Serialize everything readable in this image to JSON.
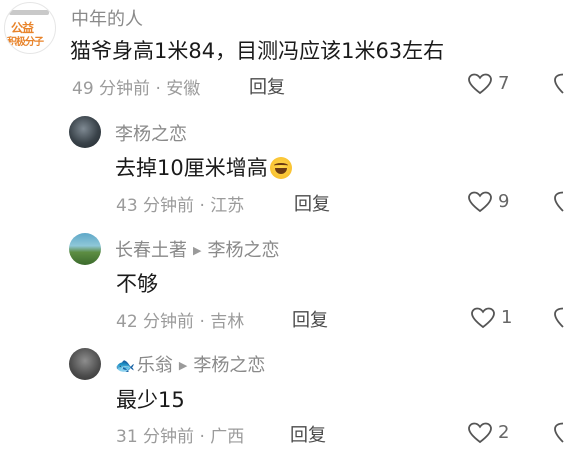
{
  "comments": [
    {
      "username": "中年的人",
      "avatar_badge": [
        "公益",
        "积极分子"
      ],
      "text": "猫爷身高1米84，目测冯应该1米63左右",
      "meta": "49 分钟前 · 安徽",
      "reply_label": "回复",
      "likes": "7"
    },
    {
      "username": "李杨之恋",
      "text": "去掉10厘米增高",
      "meta": "43 分钟前 · 江苏",
      "reply_label": "回复",
      "likes": "9"
    },
    {
      "username": "长春土著",
      "reply_to": "李杨之恋",
      "text": "不够",
      "meta": "42 分钟前 · 吉林",
      "reply_label": "回复",
      "likes": "1"
    },
    {
      "username": "乐翁",
      "reply_to": "李杨之恋",
      "text": "最少15",
      "meta": "31 分钟前 · 广西",
      "reply_label": "回复",
      "likes": "2"
    }
  ],
  "icons": {
    "like": "heart-outline-icon",
    "dislike": "broken-heart-icon",
    "reply_arrow": "triangle-right-icon",
    "fish": "fish-icon",
    "laugh_emoji": "laughing-emoji"
  },
  "colors": {
    "text_primary": "#1a1a1a",
    "text_secondary": "#8a8a8a",
    "badge_orange": "#e8832a"
  }
}
